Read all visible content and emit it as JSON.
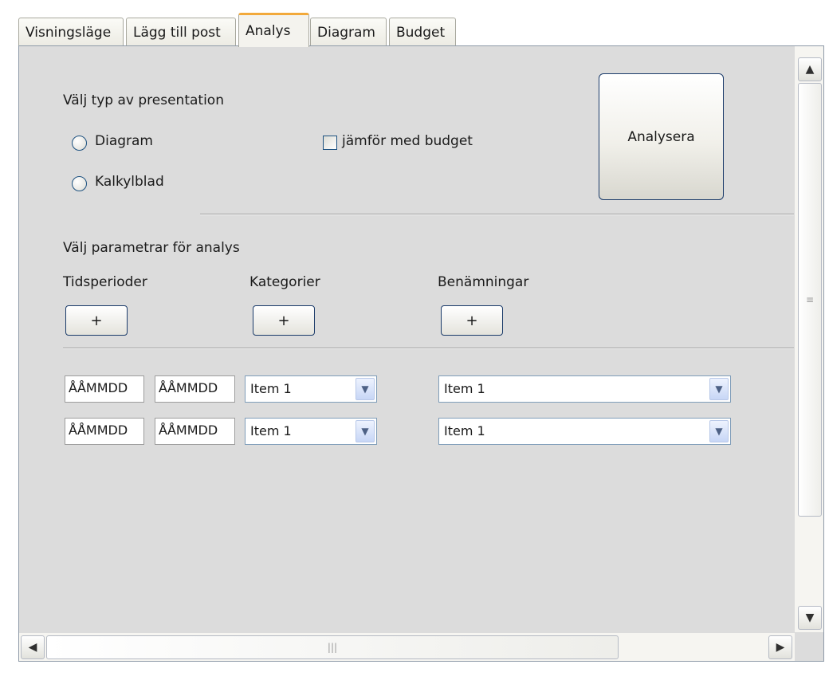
{
  "tabs": [
    {
      "label": "Visningsläge",
      "active": false
    },
    {
      "label": "Lägg till post",
      "active": false
    },
    {
      "label": "Analys",
      "active": true
    },
    {
      "label": "Diagram",
      "active": false
    },
    {
      "label": "Budget",
      "active": false
    }
  ],
  "presentation": {
    "heading": "Välj typ av presentation",
    "options": [
      "Diagram",
      "Kalkylblad"
    ],
    "compare_budget_label": "jämför med budget",
    "analyze_button": "Analysera"
  },
  "parameters": {
    "heading": "Välj parametrar för analys",
    "columns": [
      "Tidsperioder",
      "Kategorier",
      "Benämningar"
    ],
    "add_label": "+"
  },
  "rows": [
    {
      "from": "ÅÅMMDD",
      "to": "ÅÅMMDD",
      "category": "Item 1",
      "name": "Item 1"
    },
    {
      "from": "ÅÅMMDD",
      "to": "ÅÅMMDD",
      "category": "Item 1",
      "name": "Item 1"
    }
  ],
  "scrollbar": {
    "vgrip": "≡",
    "hgrip": "|||"
  },
  "icons": {
    "scroll_up": "chevron-up-icon",
    "scroll_down": "chevron-down-icon",
    "scroll_left": "chevron-left-icon",
    "scroll_right": "chevron-right-icon",
    "dropdown": "chevron-down-icon"
  },
  "colors": {
    "active_tab_accent": "#f2a93b",
    "panel_bg": "#dcdcdc",
    "button_border": "#1b3b6a",
    "control_border": "#1c5180"
  }
}
